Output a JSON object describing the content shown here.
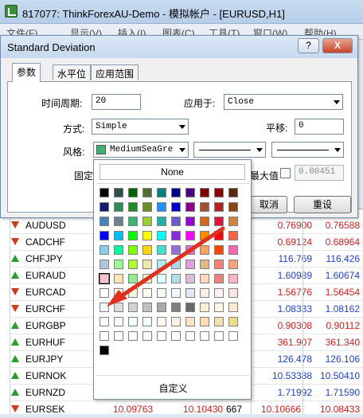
{
  "app": {
    "title": "817077: ThinkForexAU-Demo - 模拟帐户 - [EURUSD,H1]",
    "menu": [
      "文件(F)",
      "显示(V)",
      "插入(I)",
      "图表(C)",
      "工具(T)",
      "窗口(W)",
      "帮助(H)"
    ]
  },
  "dialog": {
    "title": "Standard Deviation",
    "help_label": "?",
    "close_label": "X",
    "tabs": [
      "参数",
      "水平位",
      "应用范围"
    ],
    "period_label": "时间周期:",
    "period_value": "20",
    "apply_label": "应用于:",
    "apply_value": "Close",
    "method_label": "方式:",
    "method_value": "Simple",
    "shift_label": "平移:",
    "shift_value": "0",
    "style_label": "风格:",
    "color_value": "MediumSeaGre",
    "fixed_label_partial": "固定",
    "max_label_partial": "最大值",
    "max_value": "0.00451",
    "cancel_label": "取消",
    "reset_label": "重设"
  },
  "picker": {
    "none_label": "None",
    "custom_label": "自定义",
    "selected_color": "#FFC0CB"
  },
  "market_watch": {
    "rows": [
      {
        "symbol": "AUDUSD",
        "dir": "down",
        "bid": "0.76900",
        "ask": "0.76588"
      },
      {
        "symbol": "CADCHF",
        "dir": "down",
        "bid": "0.69124",
        "ask": "0.68964"
      },
      {
        "symbol": "CHFJPY",
        "dir": "up",
        "bid": "116.769",
        "ask": "116.426"
      },
      {
        "symbol": "EURAUD",
        "dir": "up",
        "bid": "1.60989",
        "ask": "1.60674"
      },
      {
        "symbol": "EURCAD",
        "dir": "down",
        "bid": "1.56776",
        "ask": "1.56454"
      },
      {
        "symbol": "EURCHF",
        "dir": "down",
        "bid": "1.08333",
        "ask": "1.08162"
      },
      {
        "symbol": "EURGBP",
        "dir": "up",
        "bid": "0.90308",
        "ask": "0.90112"
      },
      {
        "symbol": "EURHUF",
        "dir": "up",
        "bid": "361.907",
        "ask": "361.340"
      },
      {
        "symbol": "EURJPY",
        "dir": "up",
        "bid": "126.478",
        "ask": "126.106"
      },
      {
        "symbol": "EURNOK",
        "dir": "up",
        "bid": "10.53388",
        "ask": "10.50410"
      },
      {
        "symbol": "EURNZD",
        "dir": "up",
        "bid": "1.71992",
        "ask": "1.71590"
      },
      {
        "symbol": "EURSEK",
        "dir": "down",
        "bid": "10.09763",
        "spread": "10.10430",
        "extra": "667",
        "bid2": "10.10666",
        "ask": "10.08433"
      }
    ]
  }
}
